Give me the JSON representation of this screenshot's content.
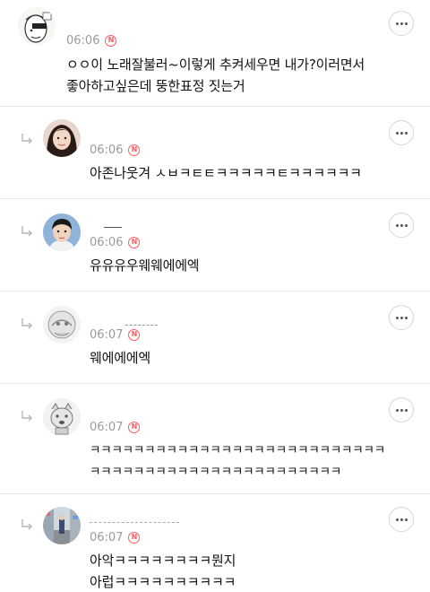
{
  "comments": [
    {
      "time": "06:06",
      "nickname": "",
      "badge": "N",
      "text": "ㅇㅇ이 노래잘불러~이렇게 추켜세우면 내가?이러면서\n좋아하고싶은데 뚱한표정 짓는거",
      "avatar": "hand-drawn-face-avatar"
    },
    {
      "time": "06:06",
      "nickname": "",
      "badge": "N",
      "text": "아존나웃겨 ㅅㅂㅋㅌㅌㅋㅋㅋㅋㅋㅌㅋㅋㅋㅋㅋㅋ",
      "avatar": "woman-portrait-avatar"
    },
    {
      "time": "06:06",
      "nickname": "",
      "badge": "N",
      "text": "유유유우웨웨에에엑",
      "avatar": "man-portrait-avatar"
    },
    {
      "time": "06:07",
      "nickname": "",
      "badge": "N",
      "text": "웨에에에엑",
      "avatar": "cartoon-character-avatar"
    },
    {
      "time": "06:07",
      "nickname": "",
      "badge": "N",
      "text": "ㅋㅋㅋㅋㅋㅋㅋㅋㅋㅋㅋㅋㅋㅋㅋㅋㅋㅋㅋㅋㅋㅋㅋㅋㅋㅋㅋ\nㅋㅋㅋㅋㅋㅋㅋㅋㅋㅋㅋㅋㅋㅋㅋㅋㅋㅋㅋㅋㅋㅋㅋ",
      "avatar": "dog-sketch-avatar"
    },
    {
      "time": "06:07",
      "nickname": "",
      "badge": "N",
      "text": "아악ㅋㅋㅋㅋㅋㅋㅋㅋ뭔지\n아럽ㅋㅋㅋㅋㅋㅋㅋㅋㅋㅋ",
      "avatar": "street-photo-avatar"
    }
  ],
  "colors": {
    "badge": "#ff5a5f",
    "meta": "#9a9a9a",
    "divider": "#e6e6e6"
  },
  "icons": {
    "reply": "reply-arrow-icon",
    "more": "more-options-icon"
  }
}
